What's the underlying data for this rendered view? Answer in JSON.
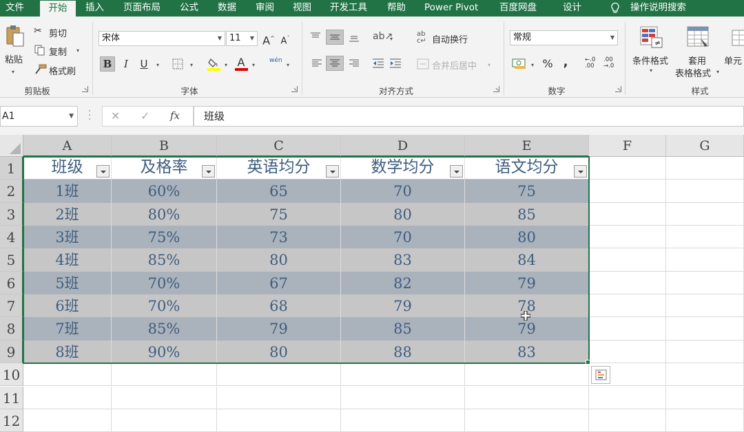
{
  "ribbon_tabs": {
    "file": "文件",
    "home": "开始",
    "insert": "插入",
    "page_layout": "页面布局",
    "formulas": "公式",
    "data": "数据",
    "review": "审阅",
    "view": "视图",
    "developer": "开发工具",
    "help": "帮助",
    "power_pivot": "Power Pivot",
    "baidu": "百度网盘",
    "design": "设计",
    "tell_me": "操作说明搜索"
  },
  "clipboard": {
    "paste": "粘贴",
    "cut": "剪切",
    "copy": "复制",
    "format_painter": "格式刷",
    "label": "剪贴板"
  },
  "font": {
    "name": "宋体",
    "size": "11",
    "grow": "A",
    "shrink": "A",
    "bold": "B",
    "italic": "I",
    "underline": "U",
    "color_letter": "A",
    "phonetic": "wén",
    "label": "字体"
  },
  "alignment": {
    "wrap_text": "自动换行",
    "merge_center": "合并后居中",
    "label": "对齐方式"
  },
  "number": {
    "format": "常规",
    "percent": "%",
    "comma": ",",
    "label": "数字"
  },
  "styles": {
    "conditional": "条件格式",
    "table_format_1": "套用",
    "table_format_2": "表格格式",
    "cell_styles": "单元",
    "label": "样式"
  },
  "formula_bar": {
    "name_box": "A1",
    "cancel": "✕",
    "enter": "✓",
    "fx": "fx",
    "content": "班级"
  },
  "sheet": {
    "columns": [
      "A",
      "B",
      "C",
      "D",
      "E",
      "F",
      "G"
    ],
    "rows": [
      "1",
      "2",
      "3",
      "4",
      "5",
      "6",
      "7",
      "8",
      "9",
      "10",
      "11",
      "12"
    ],
    "headers": [
      "班级",
      "及格率",
      "英语均分",
      "数学均分",
      "语文均分"
    ],
    "data": [
      [
        "1班",
        "60%",
        "65",
        "70",
        "75"
      ],
      [
        "2班",
        "80%",
        "75",
        "80",
        "85"
      ],
      [
        "3班",
        "75%",
        "73",
        "70",
        "80"
      ],
      [
        "4班",
        "85%",
        "80",
        "83",
        "84"
      ],
      [
        "5班",
        "70%",
        "67",
        "82",
        "79"
      ],
      [
        "6班",
        "70%",
        "68",
        "79",
        "78"
      ],
      [
        "7班",
        "85%",
        "79",
        "85",
        "79"
      ],
      [
        "8班",
        "90%",
        "80",
        "88",
        "83"
      ]
    ],
    "band_dark": "#aab2bb",
    "band_light": "#c6c6c6",
    "text_color": "#3e5d80",
    "accent": "#217346"
  }
}
